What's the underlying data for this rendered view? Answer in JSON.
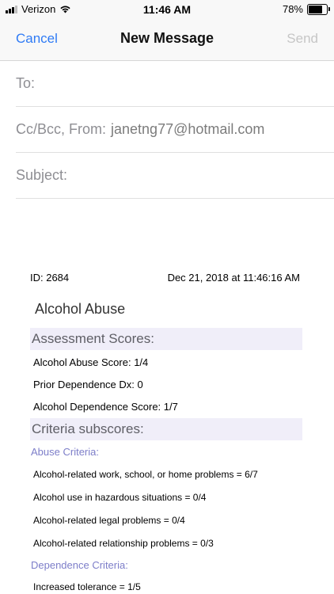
{
  "status_bar": {
    "carrier": "Verizon",
    "signal_bars_active": 3,
    "time": "11:46 AM",
    "battery_percent": "78%",
    "battery_level": 0.78,
    "icons": [
      "signal-icon",
      "wifi-icon",
      "battery-icon"
    ]
  },
  "nav": {
    "cancel": "Cancel",
    "title": "New Message",
    "send": "Send",
    "accent_color": "#2f7bf5",
    "disabled_color": "#c6c6c6"
  },
  "fields": {
    "to_label": "To:",
    "ccbcc_label": "Cc/Bcc, From:",
    "from_value": "janetng77@hotmail.com",
    "subject_label": "Subject:"
  },
  "report": {
    "id": "ID: 2684",
    "date": "Dec 21, 2018 at 11:46:16 AM",
    "title": "Alcohol Abuse",
    "assessment_heading": "Assessment Scores:",
    "scores": [
      "Alcohol Abuse Score: 1/4",
      "Prior Dependence Dx: 0",
      "Alcohol Dependence Score: 1/7"
    ],
    "criteria_heading": "Criteria subscores:",
    "abuse_heading": "Abuse Criteria:",
    "abuse_items": [
      "Alcohol-related work, school, or home problems = 6/7",
      "Alcohol use in hazardous situations = 0/4",
      "Alcohol-related legal problems = 0/4",
      "Alcohol-related relationship problems = 0/3"
    ],
    "dependence_heading": "Dependence Criteria:",
    "dependence_items": [
      "Increased tolerance = 1/5"
    ]
  }
}
